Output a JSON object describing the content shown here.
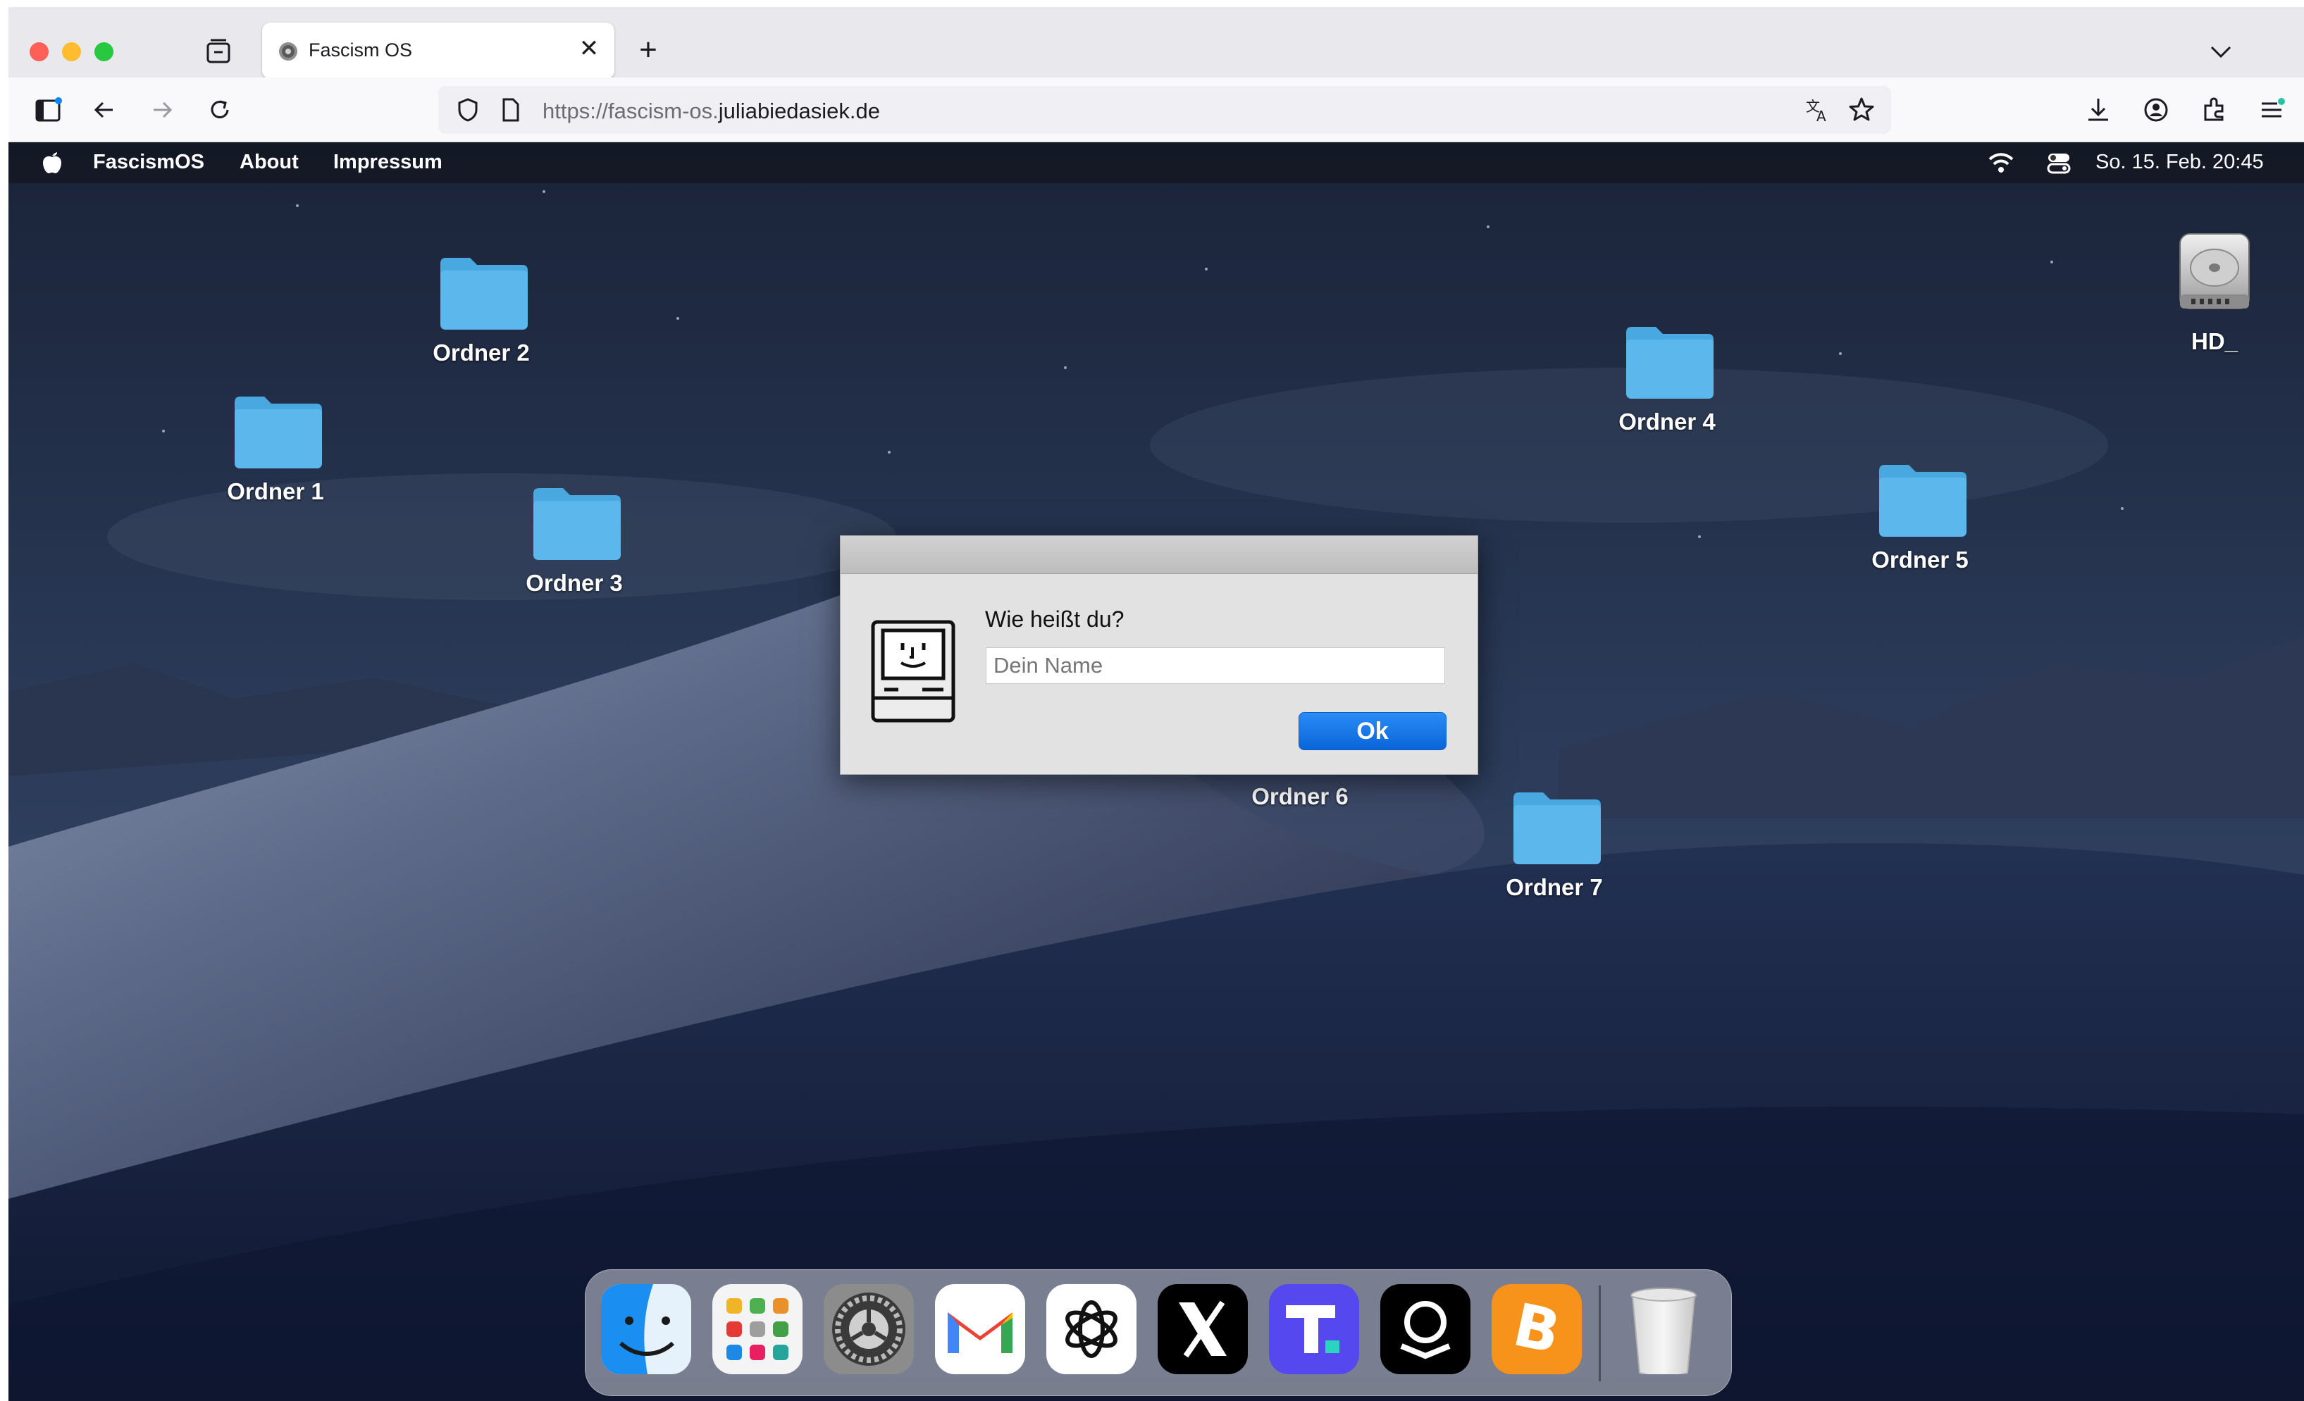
{
  "browser": {
    "tab_title": "Fascism OS",
    "tab_close": "✕",
    "new_tab": "+",
    "url_prefix": "https://fascism-os.",
    "url_domain": "juliabiedasiek.de"
  },
  "menubar": {
    "app_name": "FascismOS",
    "items": [
      "About",
      "Impressum"
    ],
    "clock": "So. 15. Feb. 20:45"
  },
  "desktop": {
    "folders": [
      "Ordner 1",
      "Ordner 2",
      "Ordner 3",
      "Ordner 4",
      "Ordner 5",
      "Ordner 6",
      "Ordner 7"
    ],
    "drive_label": "HD_"
  },
  "dialog": {
    "prompt": "Wie heißt du?",
    "input_placeholder": "Dein Name",
    "ok_label": "Ok"
  },
  "dock": {
    "items": [
      "finder-icon",
      "launchpad-icon",
      "system-settings-icon",
      "gmail-icon",
      "chatgpt-icon",
      "x-icon",
      "truth-social-icon",
      "palantir-icon",
      "bitcoin-icon",
      "trash-icon"
    ]
  },
  "colors": {
    "folder_blue": "#5cb8ec",
    "ok_button": "#1677ee",
    "bitcoin_orange": "#f7931a",
    "truth_purple": "#5448ee"
  }
}
